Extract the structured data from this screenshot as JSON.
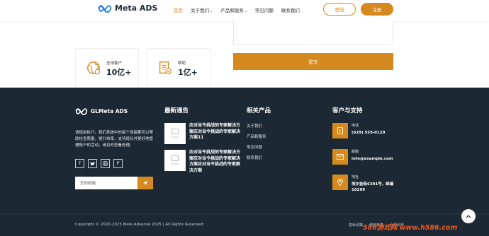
{
  "header": {
    "logo_text": "Meta ADS",
    "nav": [
      {
        "label": "首页",
        "active": true,
        "caret": false
      },
      {
        "label": "关于我们",
        "active": false,
        "caret": true
      },
      {
        "label": "产品和服务",
        "active": false,
        "caret": true
      },
      {
        "label": "常见问题",
        "active": false,
        "caret": false
      },
      {
        "label": "联系我们",
        "active": false,
        "caret": false
      }
    ],
    "login_label": "登陆",
    "register_label": "注册"
  },
  "form": {
    "submit_label": "提交"
  },
  "stats": [
    {
      "label": "全球客户",
      "value": "10亿+",
      "icon": "globe-icon"
    },
    {
      "label": "帮助",
      "value": "1亿+",
      "icon": "document-icon"
    }
  ],
  "footer": {
    "logo_text": "GLMeta ADS",
    "description": "请提前执行。我们系统中的每个连接都可以帮助检查质量，提升效率，支持增长并更好地管理账户的活动，请及时查看处理。",
    "socials": [
      "facebook-icon",
      "twitter-icon",
      "instagram-icon",
      "pinterest-icon"
    ],
    "email_placeholder": "您的邮箱",
    "news_title": "最新通告",
    "news": [
      {
        "title": "应对当今挑战的专家解决方案应对当今挑战的专家解决方案11",
        "thumb_text": "暂无图片"
      },
      {
        "title": "应对当今挑战的专家解决方案应对当今挑战的专家解决方案应对当今挑战的专家解决方案",
        "thumb_text": "暂无图片"
      }
    ],
    "products_title": "相关产品",
    "products": [
      "关于我们",
      "产品和服务",
      "常见问题",
      "联系我们"
    ],
    "support_title": "客户与支持",
    "contacts": [
      {
        "label": "电话",
        "value": "(629) 555-0129",
        "icon": "phone-icon"
      },
      {
        "label": "邮箱",
        "value": "info@example.com",
        "icon": "mail-icon"
      },
      {
        "label": "地址",
        "value": "埃尔金街6391号，邮编 10299",
        "icon": "location-icon"
      }
    ],
    "copyright": "Copyright © 2020-2025 Meta Adsense 2025 | All Rights Reserved",
    "bottom_links": [
      "隐私政策",
      "使用条款",
      "合作伙伴"
    ]
  },
  "watermark": "586游戏网 www.h586.com",
  "colors": {
    "accent": "#d48a1f",
    "footer_bg": "#1c2833",
    "logo_blue": "#1877f2"
  }
}
